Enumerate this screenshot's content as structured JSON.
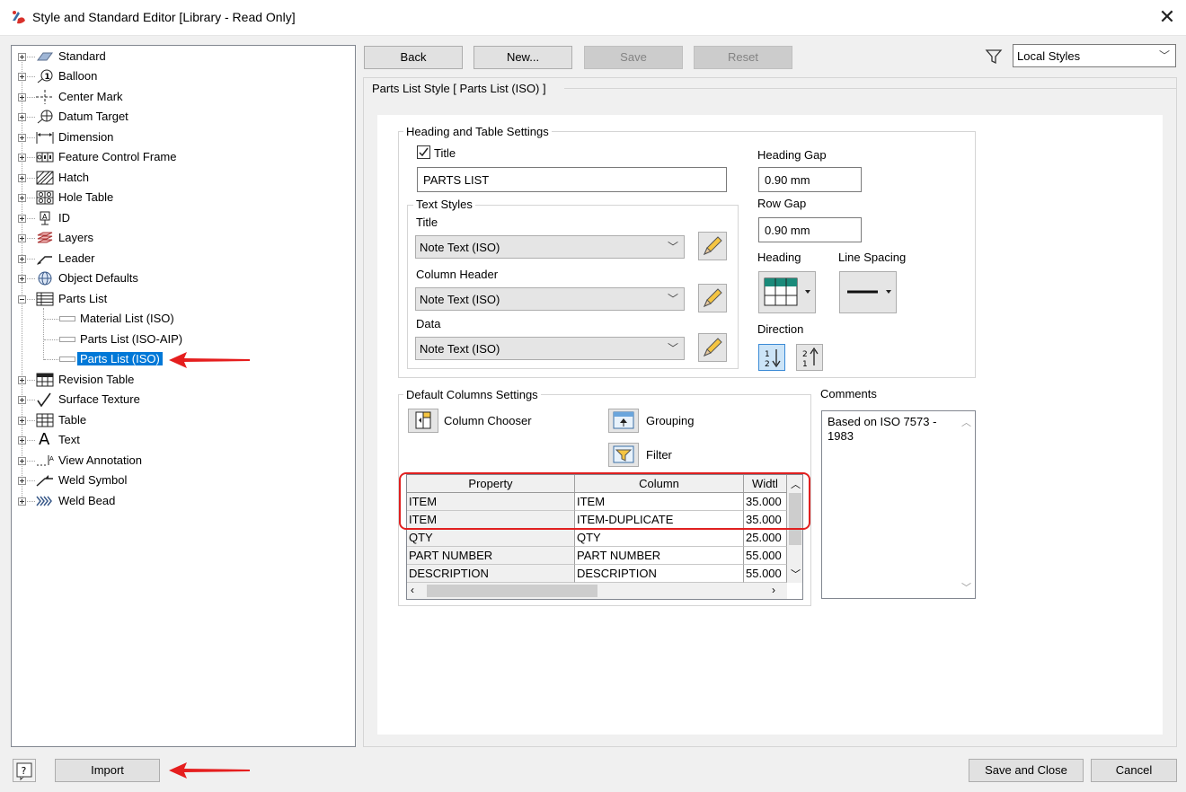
{
  "window": {
    "title": "Style and Standard Editor [Library - Read Only]"
  },
  "toolbar": {
    "back": "Back",
    "new": "New...",
    "save": "Save",
    "reset": "Reset",
    "filter_value": "Local Styles"
  },
  "tree": {
    "items": [
      {
        "label": "Standard"
      },
      {
        "label": "Balloon"
      },
      {
        "label": "Center Mark"
      },
      {
        "label": "Datum Target"
      },
      {
        "label": "Dimension"
      },
      {
        "label": "Feature Control Frame"
      },
      {
        "label": "Hatch"
      },
      {
        "label": "Hole Table"
      },
      {
        "label": "ID"
      },
      {
        "label": "Layers"
      },
      {
        "label": "Leader"
      },
      {
        "label": "Object Defaults"
      },
      {
        "label": "Parts List"
      },
      {
        "label": "Material List (ISO)"
      },
      {
        "label": "Parts List (ISO-AIP)"
      },
      {
        "label": "Parts List (ISO)"
      },
      {
        "label": "Revision Table"
      },
      {
        "label": "Surface Texture"
      },
      {
        "label": "Table"
      },
      {
        "label": "Text"
      },
      {
        "label": "View Annotation"
      },
      {
        "label": "Weld Symbol"
      },
      {
        "label": "Weld Bead"
      }
    ]
  },
  "panel": {
    "header": "Parts List Style [ Parts List (ISO) ]",
    "heading_table": {
      "group_title": "Heading and Table Settings",
      "title_checkbox": "Title",
      "title_value": "PARTS LIST",
      "heading_gap_label": "Heading Gap",
      "heading_gap_value": "0.90 mm",
      "row_gap_label": "Row Gap",
      "row_gap_value": "0.90 mm",
      "heading_label": "Heading",
      "line_spacing_label": "Line Spacing",
      "direction_label": "Direction"
    },
    "text_styles": {
      "group_title": "Text Styles",
      "title_label": "Title",
      "title_value": "Note Text (ISO)",
      "column_header_label": "Column Header",
      "column_header_value": "Note Text (ISO)",
      "data_label": "Data",
      "data_value": "Note Text (ISO)"
    },
    "default_columns": {
      "group_title": "Default Columns Settings",
      "column_chooser": "Column Chooser",
      "grouping": "Grouping",
      "filter": "Filter",
      "grid_headers": [
        "Property",
        "Column",
        "Widtl"
      ],
      "rows": [
        [
          "ITEM",
          "ITEM",
          "35.000"
        ],
        [
          "ITEM",
          "ITEM-DUPLICATE",
          "35.000"
        ],
        [
          "QTY",
          "QTY",
          "25.000"
        ],
        [
          "PART NUMBER",
          "PART NUMBER",
          "55.000"
        ],
        [
          "DESCRIPTION",
          "DESCRIPTION",
          "55.000"
        ]
      ]
    },
    "comments": {
      "label": "Comments",
      "text": "Based on ISO 7573 - 1983"
    }
  },
  "footer": {
    "import": "Import",
    "save_close": "Save and Close",
    "cancel": "Cancel"
  },
  "colors": {
    "selection": "#0078d7",
    "highlight": "#e02020",
    "teal": "#1a8a7a"
  }
}
